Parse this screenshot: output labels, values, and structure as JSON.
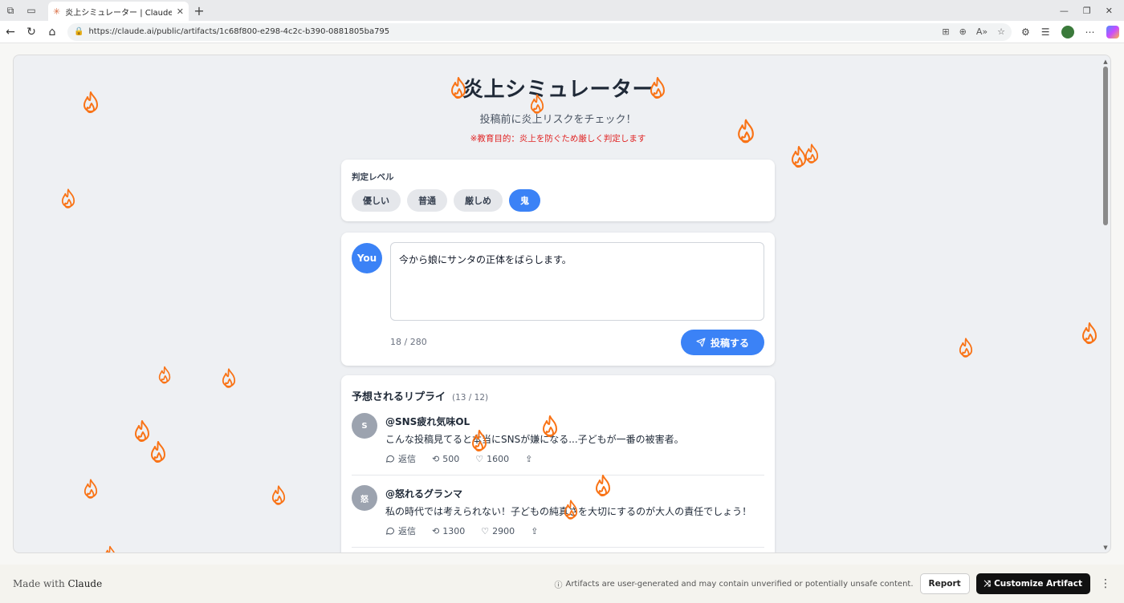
{
  "browser": {
    "tab_title": "炎上シミュレーター | Claude | Claude",
    "url": "https://claude.ai/public/artifacts/1c68f800-e298-4c2c-b390-0881805ba795"
  },
  "header": {
    "title": "炎上シミュレーター",
    "subtitle": "投稿前に炎上リスクをチェック！",
    "warning": "※教育目的：炎上を防ぐため厳しく判定します"
  },
  "level": {
    "label": "判定レベル",
    "options": [
      "優しい",
      "普通",
      "厳しめ",
      "鬼"
    ],
    "selected": "鬼"
  },
  "compose": {
    "avatar": "You",
    "text": "今から娘にサンタの正体をばらします。",
    "counter": "18 / 280",
    "post_label": "投稿する"
  },
  "replies": {
    "title": "予想されるリプライ",
    "count": "(13 / 12)",
    "items": [
      {
        "avatar": "S",
        "name": "@SNS疲れ気味OL",
        "text": "こんな投稿見てると本当にSNSが嫌になる...子どもが一番の被害者。",
        "reply_label": "返信",
        "retweets": "500",
        "likes": "1600"
      },
      {
        "avatar": "怒",
        "name": "@怒れるグランマ",
        "text": "私の時代では考えられない！子どもの純真さを大切にするのが大人の責任でしょう！",
        "reply_label": "返信",
        "retweets": "1300",
        "likes": "2900"
      }
    ]
  },
  "footer": {
    "made_with": "Made with",
    "brand": "Claude",
    "disclaimer": "Artifacts are user-generated and may contain unverified or potentially unsafe content.",
    "report": "Report",
    "customize": "Customize Artifact"
  },
  "colors": {
    "accent": "#3b82f6",
    "flame": "#f97316",
    "warning": "#e02424"
  }
}
